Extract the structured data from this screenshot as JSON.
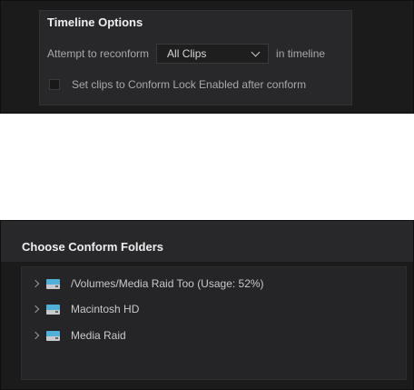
{
  "timeline_options": {
    "title": "Timeline Options",
    "reconform_label": "Attempt to reconform",
    "reconform_value": "All Clips",
    "reconform_suffix": "in timeline",
    "conform_lock_label": "Set clips to Conform Lock Enabled after conform",
    "conform_lock_checked": false
  },
  "conform_folders": {
    "title": "Choose Conform Folders",
    "items": [
      {
        "label": "/Volumes/Media Raid Too (Usage: 52%)",
        "icon": "drive-icon",
        "expanded": false
      },
      {
        "label": "Macintosh HD",
        "icon": "drive-icon",
        "expanded": false
      },
      {
        "label": "Media Raid",
        "icon": "drive-icon",
        "expanded": false
      }
    ]
  },
  "colors": {
    "panel_bg": "#1b1b1c",
    "section_bg": "#28282a",
    "drive_accent": "#4fb0da"
  }
}
